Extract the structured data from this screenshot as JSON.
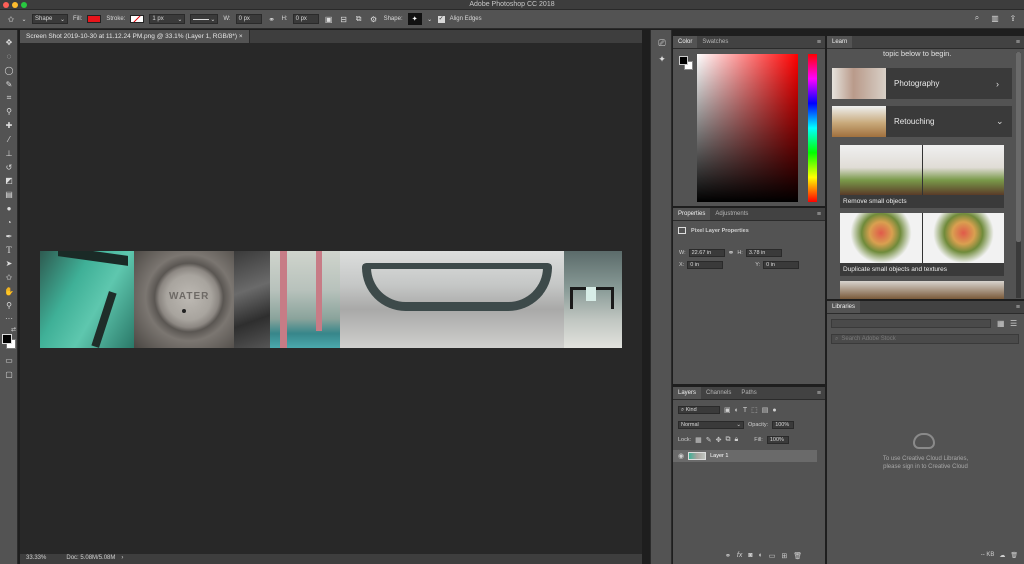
{
  "window": {
    "title": "Adobe Photoshop CC 2018"
  },
  "options_bar": {
    "mode": "Shape",
    "fill_label": "Fill:",
    "stroke_label": "Stroke:",
    "stroke_width": "1 px",
    "w_label": "W:",
    "w_value": "0 px",
    "h_label": "H:",
    "h_value": "0 px",
    "shape_label": "Shape:",
    "align_edges": "Align Edges",
    "fill_color": "#e8141a"
  },
  "document": {
    "tab_title": "Screen Shot 2019-10-30 at 11.12.24 PM.png @ 33.1% (Layer 1, RGB/8*)",
    "zoom": "33.33%",
    "doc_size": "Doc: 5.08M/5.08M",
    "image_text": "WATER"
  },
  "tools": [
    "move-tool",
    "marquee-tool",
    "lasso-tool",
    "quick-select-tool",
    "crop-tool",
    "eyedropper-tool",
    "healing-tool",
    "brush-tool",
    "stamp-tool",
    "history-brush-tool",
    "eraser-tool",
    "gradient-tool",
    "blur-tool",
    "dodge-tool",
    "pen-tool",
    "type-tool",
    "path-select-tool",
    "custom-shape-tool",
    "hand-tool",
    "zoom-tool",
    "more-tool"
  ],
  "color_panel": {
    "tabs": [
      "Color",
      "Swatches"
    ],
    "hue": "#ff0000"
  },
  "properties_panel": {
    "tabs": [
      "Properties",
      "Adjustments"
    ],
    "heading": "Pixel Layer Properties",
    "w_label": "W:",
    "w_value": "22.67 in",
    "h_label": "H:",
    "h_value": "3.78 in",
    "x_label": "X:",
    "x_value": "0 in",
    "y_label": "Y:",
    "y_value": "0 in"
  },
  "layers_panel": {
    "tabs": [
      "Layers",
      "Channels",
      "Paths"
    ],
    "filter_kind": "Kind",
    "blend_mode": "Normal",
    "opacity_label": "Opacity:",
    "opacity": "100%",
    "lock_label": "Lock:",
    "fill_label": "Fill:",
    "fill": "100%",
    "layers": [
      {
        "name": "Layer 1",
        "visible": true
      }
    ]
  },
  "learn_panel": {
    "tab": "Learn",
    "intro": "topic below to begin.",
    "topics": [
      {
        "label": "Photography",
        "chevron": "›"
      },
      {
        "label": "Retouching",
        "chevron": "⌄"
      }
    ],
    "tutorials": [
      "Remove small objects",
      "Duplicate small objects and textures"
    ]
  },
  "libraries_panel": {
    "tab": "Libraries",
    "search_placeholder": "Search Adobe Stock",
    "message_line1": "To use Creative Cloud Libraries,",
    "message_line2": "please sign in to Creative Cloud",
    "size": "-- KB"
  }
}
